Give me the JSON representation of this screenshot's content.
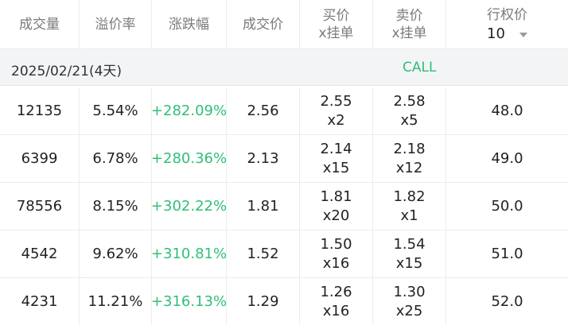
{
  "header": {
    "volume": "成交量",
    "premium": "溢价率",
    "change": "涨跌幅",
    "last": "成交价",
    "bid_line1": "买价",
    "bid_line2": "x挂单",
    "ask_line1": "卖价",
    "ask_line2": "x挂单",
    "strike": "行权价",
    "strike_count": "10"
  },
  "expiry": {
    "date": "2025/02/21(4天)",
    "side": "CALL"
  },
  "colors": {
    "up": "#2fbf78",
    "header_text": "#7a7a7a",
    "section_bg": "#f3f4f6"
  },
  "rows": [
    {
      "volume": "12135",
      "premium": "5.54%",
      "change": "+282.09%",
      "last": "2.56",
      "bid": "2.55",
      "bid_size": "x2",
      "ask": "2.58",
      "ask_size": "x5",
      "strike": "48.0"
    },
    {
      "volume": "6399",
      "premium": "6.78%",
      "change": "+280.36%",
      "last": "2.13",
      "bid": "2.14",
      "bid_size": "x15",
      "ask": "2.18",
      "ask_size": "x12",
      "strike": "49.0"
    },
    {
      "volume": "78556",
      "premium": "8.15%",
      "change": "+302.22%",
      "last": "1.81",
      "bid": "1.81",
      "bid_size": "x20",
      "ask": "1.82",
      "ask_size": "x1",
      "strike": "50.0"
    },
    {
      "volume": "4542",
      "premium": "9.62%",
      "change": "+310.81%",
      "last": "1.52",
      "bid": "1.50",
      "bid_size": "x16",
      "ask": "1.54",
      "ask_size": "x15",
      "strike": "51.0"
    },
    {
      "volume": "4231",
      "premium": "11.21%",
      "change": "+316.13%",
      "last": "1.29",
      "bid": "1.26",
      "bid_size": "x16",
      "ask": "1.30",
      "ask_size": "x25",
      "strike": "52.0"
    }
  ]
}
